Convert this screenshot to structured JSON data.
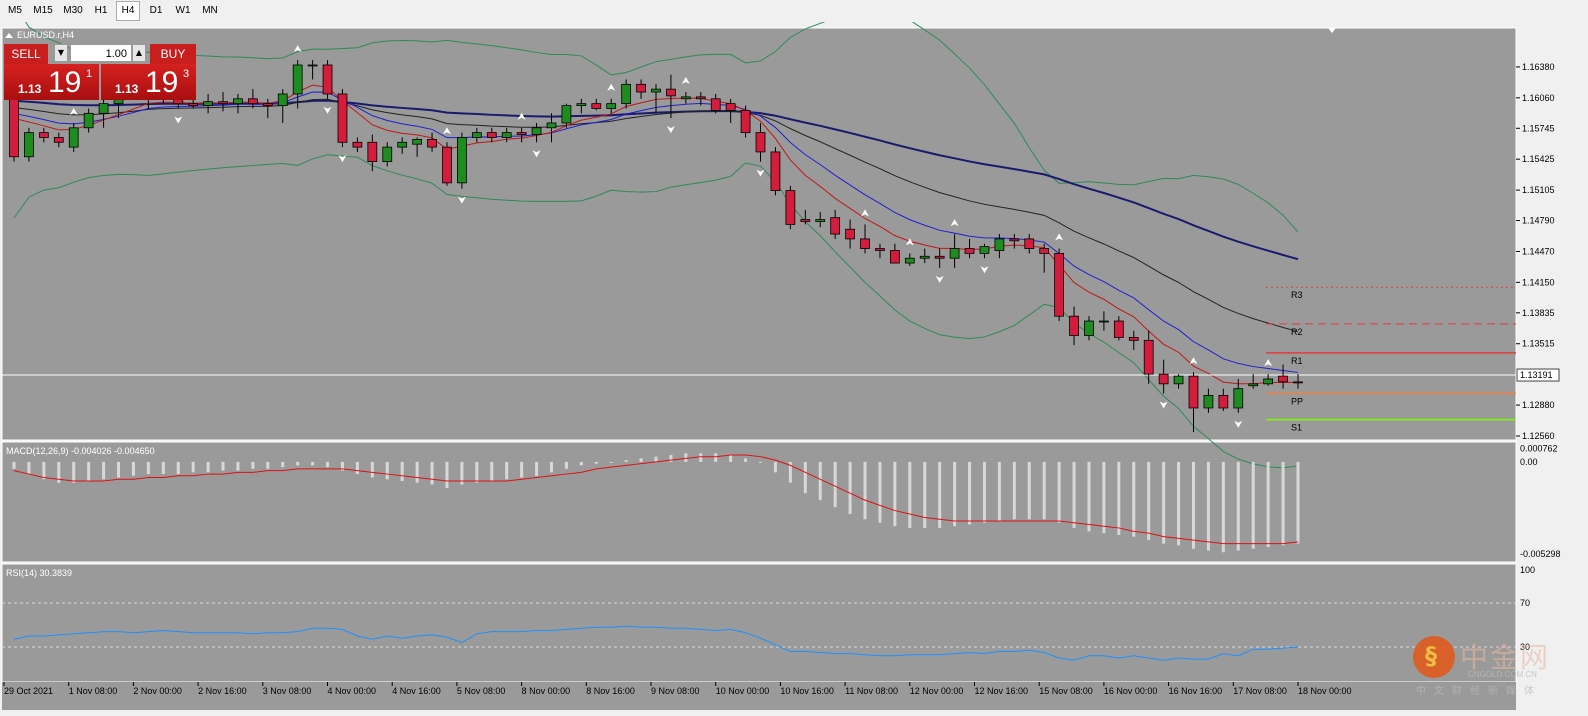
{
  "timeframes": {
    "items": [
      "M5",
      "M15",
      "M30",
      "H1",
      "H4",
      "D1",
      "W1",
      "MN"
    ],
    "active": "H4"
  },
  "trade_panel": {
    "sell_label": "SELL",
    "buy_label": "BUY",
    "lot": "1.00",
    "sell_price": {
      "prefix": "1.13",
      "big": "19",
      "sup": "1"
    },
    "buy_price": {
      "prefix": "1.13",
      "big": "19",
      "sup": "3"
    }
  },
  "chart_data": {
    "type": "candlestick",
    "symbol_label": "EURUSD.r,H4",
    "y_ticks": [
      "1.16380",
      "1.16060",
      "1.15745",
      "1.15425",
      "1.15105",
      "1.14790",
      "1.14470",
      "1.14150",
      "1.13835",
      "1.13515",
      "1.13191",
      "1.12880",
      "1.12560"
    ],
    "ylim": [
      1.1256,
      1.167
    ],
    "current_price": "1.13191",
    "x_labels": [
      "29 Oct 2021",
      "1 Nov 08:00",
      "2 Nov 00:00",
      "2 Nov 16:00",
      "3 Nov 08:00",
      "4 Nov 00:00",
      "4 Nov 16:00",
      "5 Nov 08:00",
      "8 Nov 00:00",
      "8 Nov 16:00",
      "9 Nov 08:00",
      "10 Nov 00:00",
      "10 Nov 16:00",
      "11 Nov 08:00",
      "12 Nov 00:00",
      "12 Nov 16:00",
      "15 Nov 08:00",
      "16 Nov 00:00",
      "16 Nov 16:00",
      "17 Nov 08:00",
      "18 Nov 00:00"
    ],
    "candles": [
      [
        1.161,
        1.1625,
        1.154,
        1.1545
      ],
      [
        1.1545,
        1.1575,
        1.154,
        1.157
      ],
      [
        1.157,
        1.1575,
        1.156,
        1.1565
      ],
      [
        1.1565,
        1.157,
        1.1555,
        1.156
      ],
      [
        1.1555,
        1.158,
        1.155,
        1.1575
      ],
      [
        1.1575,
        1.1595,
        1.157,
        1.159
      ],
      [
        1.159,
        1.161,
        1.1575,
        1.16
      ],
      [
        1.16,
        1.1615,
        1.1585,
        1.1605
      ],
      [
        1.161,
        1.163,
        1.1605,
        1.1612
      ],
      [
        1.1612,
        1.1625,
        1.1595,
        1.1618
      ],
      [
        1.1618,
        1.163,
        1.16,
        1.1605
      ],
      [
        1.1605,
        1.1615,
        1.1595,
        1.16
      ],
      [
        1.16,
        1.161,
        1.1595,
        1.1598
      ],
      [
        1.1598,
        1.161,
        1.159,
        1.1602
      ],
      [
        1.1602,
        1.1612,
        1.1592,
        1.16
      ],
      [
        1.16,
        1.161,
        1.159,
        1.1605
      ],
      [
        1.1605,
        1.1615,
        1.1595,
        1.16
      ],
      [
        1.16,
        1.1605,
        1.1585,
        1.1598
      ],
      [
        1.1598,
        1.1615,
        1.158,
        1.161
      ],
      [
        1.161,
        1.1645,
        1.1595,
        1.164
      ],
      [
        1.164,
        1.1645,
        1.1625,
        1.164
      ],
      [
        1.164,
        1.1645,
        1.1605,
        1.161
      ],
      [
        1.161,
        1.1615,
        1.1555,
        1.156
      ],
      [
        1.156,
        1.1565,
        1.155,
        1.1555
      ],
      [
        1.156,
        1.1568,
        1.153,
        1.154
      ],
      [
        1.154,
        1.156,
        1.1535,
        1.1555
      ],
      [
        1.1555,
        1.1565,
        1.1548,
        1.156
      ],
      [
        1.1558,
        1.1565,
        1.1545,
        1.1563
      ],
      [
        1.1563,
        1.157,
        1.155,
        1.1555
      ],
      [
        1.1555,
        1.156,
        1.1515,
        1.1518
      ],
      [
        1.1518,
        1.157,
        1.1512,
        1.1565
      ],
      [
        1.1565,
        1.1575,
        1.156,
        1.157
      ],
      [
        1.157,
        1.1575,
        1.156,
        1.1565
      ],
      [
        1.1565,
        1.1575,
        1.156,
        1.157
      ],
      [
        1.157,
        1.1575,
        1.156,
        1.1568
      ],
      [
        1.1568,
        1.158,
        1.156,
        1.1575
      ],
      [
        1.1575,
        1.159,
        1.156,
        1.158
      ],
      [
        1.158,
        1.16,
        1.1575,
        1.1598
      ],
      [
        1.1598,
        1.1605,
        1.159,
        1.16
      ],
      [
        1.16,
        1.1605,
        1.1593,
        1.1595
      ],
      [
        1.1595,
        1.1605,
        1.159,
        1.16
      ],
      [
        1.16,
        1.1625,
        1.1595,
        1.162
      ],
      [
        1.162,
        1.1625,
        1.1605,
        1.1612
      ],
      [
        1.1612,
        1.162,
        1.159,
        1.1615
      ],
      [
        1.1615,
        1.163,
        1.1585,
        1.1608
      ],
      [
        1.1605,
        1.1612,
        1.16,
        1.1607
      ],
      [
        1.1607,
        1.1612,
        1.1598,
        1.1605
      ],
      [
        1.1605,
        1.161,
        1.159,
        1.1593
      ],
      [
        1.16,
        1.1605,
        1.158,
        1.1593
      ],
      [
        1.1593,
        1.1598,
        1.1565,
        1.157
      ],
      [
        1.157,
        1.158,
        1.154,
        1.155
      ],
      [
        1.155,
        1.1555,
        1.1505,
        1.151
      ],
      [
        1.151,
        1.1515,
        1.147,
        1.1475
      ],
      [
        1.148,
        1.149,
        1.1475,
        1.1478
      ],
      [
        1.1478,
        1.1488,
        1.1472,
        1.148
      ],
      [
        1.1482,
        1.149,
        1.146,
        1.1465
      ],
      [
        1.147,
        1.148,
        1.145,
        1.146
      ],
      [
        1.146,
        1.1475,
        1.1445,
        1.145
      ],
      [
        1.145,
        1.1455,
        1.144,
        1.1448
      ],
      [
        1.1448,
        1.1455,
        1.1435,
        1.1435
      ],
      [
        1.1435,
        1.1445,
        1.1432,
        1.144
      ],
      [
        1.144,
        1.145,
        1.1435,
        1.1442
      ],
      [
        1.1442,
        1.145,
        1.143,
        1.144
      ],
      [
        1.144,
        1.1465,
        1.143,
        1.145
      ],
      [
        1.145,
        1.146,
        1.144,
        1.1445
      ],
      [
        1.1445,
        1.1455,
        1.144,
        1.1452
      ],
      [
        1.1448,
        1.1465,
        1.144,
        1.146
      ],
      [
        1.146,
        1.1465,
        1.145,
        1.1458
      ],
      [
        1.146,
        1.1465,
        1.1445,
        1.145
      ],
      [
        1.145,
        1.1455,
        1.1425,
        1.1445
      ],
      [
        1.1445,
        1.145,
        1.1375,
        1.138
      ],
      [
        1.138,
        1.139,
        1.135,
        1.136
      ],
      [
        1.136,
        1.138,
        1.1355,
        1.1375
      ],
      [
        1.1375,
        1.1385,
        1.1365,
        1.1375
      ],
      [
        1.1375,
        1.138,
        1.1355,
        1.1358
      ],
      [
        1.1358,
        1.1365,
        1.1345,
        1.1355
      ],
      [
        1.1355,
        1.1365,
        1.131,
        1.132
      ],
      [
        1.132,
        1.1335,
        1.13,
        1.131
      ],
      [
        1.131,
        1.132,
        1.1305,
        1.1318
      ],
      [
        1.1318,
        1.1322,
        1.126,
        1.1285
      ],
      [
        1.1285,
        1.1305,
        1.128,
        1.1298
      ],
      [
        1.1298,
        1.1305,
        1.1282,
        1.1285
      ],
      [
        1.1285,
        1.1315,
        1.128,
        1.1305
      ],
      [
        1.1308,
        1.132,
        1.1305,
        1.131
      ],
      [
        1.131,
        1.132,
        1.1308,
        1.1315
      ],
      [
        1.1318,
        1.133,
        1.1305,
        1.1312
      ],
      [
        1.1312,
        1.132,
        1.1305,
        1.1311
      ]
    ],
    "pivots": [
      {
        "name": "R3",
        "value": 1.141,
        "color": "#e23c3c",
        "style": "dot"
      },
      {
        "name": "R2",
        "value": 1.1372,
        "color": "#e23c3c",
        "style": "dash"
      },
      {
        "name": "R1",
        "value": 1.1342,
        "color": "#e23c3c",
        "style": "solid"
      },
      {
        "name": "PP",
        "value": 1.13,
        "color": "#f08040",
        "style": "solid"
      },
      {
        "name": "S1",
        "value": 1.1273,
        "color": "#7cfc00",
        "style": "solid"
      }
    ],
    "macd": {
      "label": "MACD(12,26,9) -0.004026 -0.004650",
      "y_ticks": [
        "0.000762",
        "0.00",
        "-0.005298"
      ],
      "ylim": [
        -0.0053,
        0.0008
      ],
      "hist": [
        -0.0004,
        -0.0007,
        -0.001,
        -0.0012,
        -0.0012,
        -0.0011,
        -0.001,
        -0.0009,
        -0.0008,
        -0.0007,
        -0.0007,
        -0.0007,
        -0.0006,
        -0.0006,
        -0.0005,
        -0.0005,
        -0.0004,
        -0.0004,
        -0.0003,
        -0.0002,
        -0.0002,
        -0.0003,
        -0.0005,
        -0.0007,
        -0.0009,
        -0.001,
        -0.0011,
        -0.0012,
        -0.0013,
        -0.0015,
        -0.0013,
        -0.0012,
        -0.0011,
        -0.001,
        -0.0009,
        -0.0008,
        -0.0006,
        -0.0004,
        -0.0002,
        -0.0001,
        0.0,
        0.0001,
        0.0002,
        0.0003,
        0.0004,
        0.0005,
        0.0005,
        0.0005,
        0.0004,
        0.0002,
        0.0,
        -0.0006,
        -0.0012,
        -0.0018,
        -0.0022,
        -0.0026,
        -0.003,
        -0.0033,
        -0.0035,
        -0.0037,
        -0.0038,
        -0.0038,
        -0.0038,
        -0.0037,
        -0.0036,
        -0.0035,
        -0.0034,
        -0.0033,
        -0.0033,
        -0.0033,
        -0.0035,
        -0.0038,
        -0.004,
        -0.0041,
        -0.0042,
        -0.0043,
        -0.0045,
        -0.0047,
        -0.0048,
        -0.005,
        -0.0051,
        -0.0052,
        -0.0051,
        -0.005,
        -0.0049,
        -0.0048,
        -0.0047
      ],
      "signal": [
        -0.0005,
        -0.0007,
        -0.0009,
        -0.001,
        -0.0011,
        -0.0011,
        -0.0011,
        -0.001,
        -0.001,
        -0.0009,
        -0.0009,
        -0.0008,
        -0.0008,
        -0.0007,
        -0.0007,
        -0.0006,
        -0.0006,
        -0.0005,
        -0.0005,
        -0.0004,
        -0.0004,
        -0.0004,
        -0.0004,
        -0.0005,
        -0.0006,
        -0.0007,
        -0.0008,
        -0.0009,
        -0.001,
        -0.0011,
        -0.0011,
        -0.0011,
        -0.0011,
        -0.0011,
        -0.001,
        -0.0009,
        -0.0008,
        -0.0007,
        -0.0006,
        -0.0004,
        -0.0003,
        -0.0002,
        -0.0001,
        0.0,
        0.0001,
        0.0002,
        0.0003,
        0.0003,
        0.0004,
        0.0004,
        0.0003,
        0.0001,
        -0.0002,
        -0.0006,
        -0.001,
        -0.0014,
        -0.0018,
        -0.0022,
        -0.0025,
        -0.0028,
        -0.003,
        -0.0032,
        -0.0033,
        -0.0034,
        -0.0034,
        -0.0034,
        -0.0034,
        -0.0034,
        -0.0034,
        -0.0034,
        -0.0034,
        -0.0035,
        -0.0036,
        -0.0037,
        -0.0038,
        -0.004,
        -0.0041,
        -0.0043,
        -0.0044,
        -0.0045,
        -0.0046,
        -0.0047,
        -0.0047,
        -0.0047,
        -0.0047,
        -0.0047,
        -0.0046
      ]
    },
    "rsi": {
      "label": "RSI(14) 30.3839",
      "y_ticks": [
        "100",
        "70",
        "30",
        "0"
      ],
      "levels": [
        70,
        30
      ],
      "values": [
        37,
        40,
        40,
        41,
        42,
        43,
        44,
        44,
        43,
        44,
        45,
        44,
        43,
        43,
        43,
        43,
        42,
        43,
        43,
        44,
        47,
        47,
        46,
        40,
        37,
        40,
        38,
        40,
        41,
        39,
        34,
        42,
        44,
        44,
        44,
        45,
        45,
        46,
        47,
        48,
        48,
        49,
        48,
        48,
        47,
        47,
        46,
        45,
        46,
        43,
        38,
        32,
        26,
        26,
        25,
        24,
        24,
        23,
        22,
        22,
        23,
        23,
        23,
        24,
        25,
        24,
        26,
        26,
        27,
        25,
        20,
        18,
        22,
        22,
        20,
        22,
        20,
        18,
        20,
        19,
        19,
        24,
        22,
        28,
        28,
        29,
        30
      ]
    }
  },
  "watermark": {
    "text": "中金网",
    "sub": "CNGOLD.COM.CN",
    "cn": "中文财经新媒体"
  }
}
